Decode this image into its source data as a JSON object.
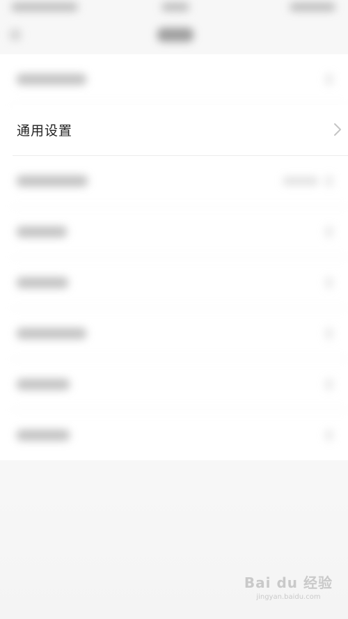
{
  "settings": {
    "items": [
      {
        "label": "",
        "blurred": true
      },
      {
        "label": "通用设置",
        "blurred": false
      },
      {
        "label": "",
        "blurred": true
      },
      {
        "label": "",
        "blurred": true
      },
      {
        "label": "",
        "blurred": true
      },
      {
        "label": "",
        "blurred": true
      },
      {
        "label": "",
        "blurred": true
      },
      {
        "label": "",
        "blurred": true
      }
    ]
  },
  "watermark": {
    "brand": "Bai du 经验",
    "site": "jingyan.baidu.com"
  },
  "colors": {
    "background": "#f7f7f7",
    "row_background": "#ffffff",
    "text": "#222222",
    "divider": "#ececec"
  },
  "icons": {
    "chevron": "chevron-right-icon",
    "back": "back-arrow-icon"
  }
}
